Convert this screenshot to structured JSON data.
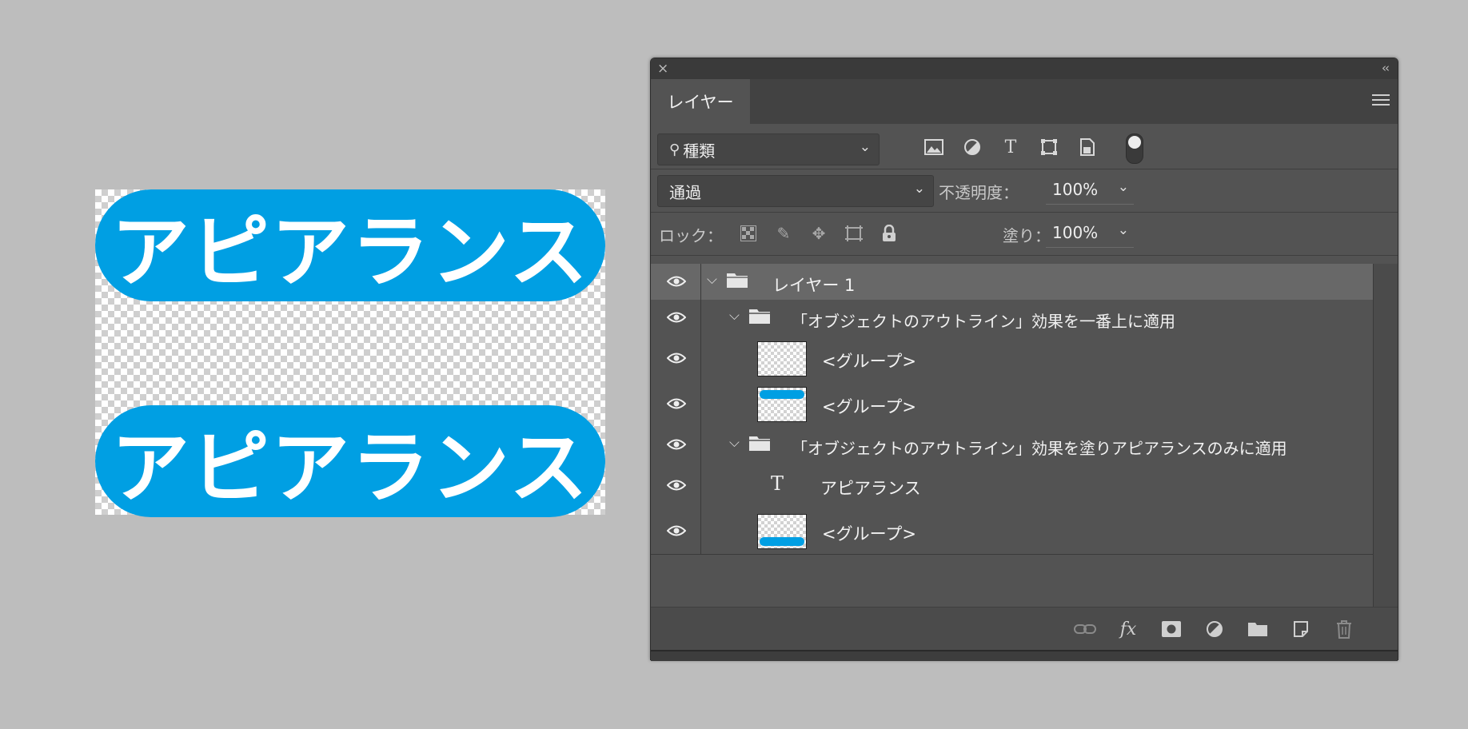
{
  "artwork": {
    "text_top": "アピアランス",
    "text_bottom": "アピアランス",
    "fill_color": "#009fe3"
  },
  "panel": {
    "close_glyph": "×",
    "collapse_glyph": "‹‹",
    "tab_label": "レイヤー",
    "filter": {
      "value": "種類",
      "search_icon": "search-icon"
    },
    "filter_icons": [
      "image-filter-icon",
      "adjustment-filter-icon",
      "type-filter-icon",
      "shape-filter-icon",
      "smartobject-filter-icon"
    ],
    "blend_mode": "通過",
    "opacity_label": "不透明度：",
    "opacity_value": "100%",
    "lock_label": "ロック：",
    "lock_icons": [
      "lock-transparent-icon",
      "lock-paint-icon",
      "lock-move-icon",
      "lock-artboard-icon",
      "lock-all-icon"
    ],
    "fill_label": "塗り：",
    "fill_value": "100%"
  },
  "layers": [
    {
      "name": "レイヤー 1",
      "type": "group",
      "selected": true
    },
    {
      "name": "「オブジェクトのアウトライン」効果を一番上に適用",
      "type": "group"
    },
    {
      "name": "<グループ>",
      "type": "layer",
      "thumb": "empty"
    },
    {
      "name": "<グループ>",
      "type": "layer",
      "thumb": "bar-top"
    },
    {
      "name": "「オブジェクトのアウトライン」効果を塗りアピアランスのみに適用",
      "type": "group"
    },
    {
      "name": "アピアランス",
      "type": "text",
      "icon": "T"
    },
    {
      "name": "<グループ>",
      "type": "layer",
      "thumb": "bar-bottom"
    }
  ],
  "footer_icons": [
    "link-icon",
    "fx-icon",
    "mask-icon",
    "adjustment-icon",
    "folder-icon",
    "new-layer-icon",
    "trash-icon"
  ],
  "fx_label": "fx"
}
